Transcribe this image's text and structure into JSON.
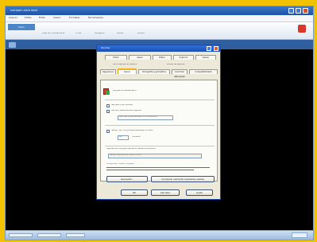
{
  "window": {
    "title": "Microsoft Office Word",
    "controls": [
      "minimize",
      "maximize",
      "close"
    ]
  },
  "menubar": {
    "items": [
      "Arquivo",
      "Editar",
      "Exibir",
      "Inserir",
      "Formatar",
      "Ferramentas"
    ]
  },
  "ribbon": {
    "active_tab": "Início",
    "labels": [
      "Área de Transferência",
      "Fonte",
      "Parágrafo",
      "Estilos",
      "Edição"
    ]
  },
  "dialog": {
    "title": "Opções",
    "tabs_row1": [
      "Exibir",
      "Geral",
      "Editar",
      "Imprimir",
      "Salvar"
    ],
    "tabs_row2": [
      "Segurança",
      "Ortografia e gramática",
      "Controlar alterações",
      "Informações do usuário",
      "Compatibilidade",
      "Locais de arquivo"
    ],
    "active_tab": "Salvar",
    "sections": {
      "options_header": "Opções de salvamento",
      "opt1": "Sempre criar backup",
      "opt2": "Permitir salvamentos rápidos",
      "opt3": "Solicitar propriedades do documento",
      "autorecover_label": "Salvar info. de AutoRecuperação a cada:",
      "autorecover_value": "10",
      "autorecover_unit": "minutos",
      "embed_header": "Opções de compartilhamento deste documento",
      "embed_label": "Incorporar fontes TrueType",
      "note": "Salvar arquivos do Word como:"
    },
    "buttons": {
      "advanced": "Avançado...",
      "checkbox_label": "Incorporar somente caracteres usados",
      "ok": "OK",
      "cancel": "Cancelar",
      "help": "Ajuda"
    }
  },
  "colors": {
    "frame_background": "#f2c200",
    "title_bar": "#1d52a5",
    "stage": "#000000"
  }
}
